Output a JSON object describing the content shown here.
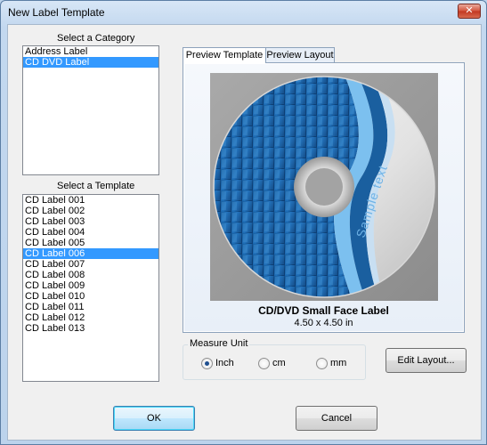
{
  "window": {
    "title": "New Label Template",
    "close_glyph": "✕"
  },
  "category": {
    "caption": "Select a Category",
    "items": [
      {
        "label": "Address Label",
        "selected": false
      },
      {
        "label": "CD DVD Label",
        "selected": true
      }
    ]
  },
  "template": {
    "caption": "Select a Template",
    "items": [
      {
        "label": "CD Label 001",
        "selected": false
      },
      {
        "label": "CD Label 002",
        "selected": false
      },
      {
        "label": "CD Label 003",
        "selected": false
      },
      {
        "label": "CD Label 004",
        "selected": false
      },
      {
        "label": "CD Label 005",
        "selected": false
      },
      {
        "label": "CD Label 006",
        "selected": true
      },
      {
        "label": "CD Label 007",
        "selected": false
      },
      {
        "label": "CD Label 008",
        "selected": false
      },
      {
        "label": "CD Label 009",
        "selected": false
      },
      {
        "label": "CD Label 010",
        "selected": false
      },
      {
        "label": "CD Label 011",
        "selected": false
      },
      {
        "label": "CD Label 012",
        "selected": false
      },
      {
        "label": "CD Label 013",
        "selected": false
      }
    ]
  },
  "tabs": [
    {
      "label": "Preview Template",
      "active": true
    },
    {
      "label": "Preview Layout",
      "active": false
    }
  ],
  "preview": {
    "disc_text": "Sample text",
    "label_name": "CD/DVD Small Face Label",
    "label_size": "4.50 x 4.50 in"
  },
  "measure_unit": {
    "legend": "Measure Unit",
    "options": [
      {
        "label": "Inch",
        "checked": true
      },
      {
        "label": "cm",
        "checked": false
      },
      {
        "label": "mm",
        "checked": false
      }
    ]
  },
  "buttons": {
    "edit_layout": "Edit Layout...",
    "ok": "OK",
    "cancel": "Cancel"
  },
  "colors": {
    "selection": "#3399ff",
    "disc_blue": "#1f6fb8",
    "disc_accent": "#7cc0ef"
  }
}
